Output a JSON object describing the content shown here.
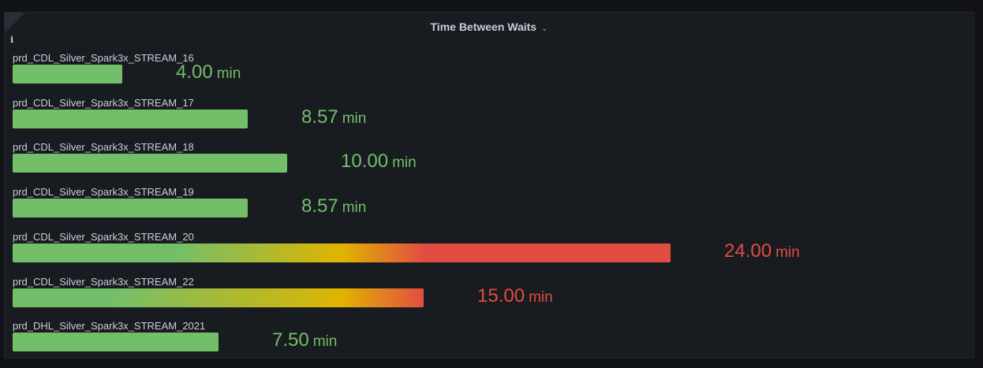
{
  "panel": {
    "title": "Time Between Waits",
    "info_icon": "info-icon",
    "menu_icon": "chevron-down-icon"
  },
  "chart_data": {
    "type": "bar",
    "orientation": "horizontal",
    "title": "Time Between Waits",
    "unit": "min",
    "xlim": [
      0,
      24
    ],
    "categories": [
      "prd_CDL_Silver_Spark3x_STREAM_16",
      "prd_CDL_Silver_Spark3x_STREAM_17",
      "prd_CDL_Silver_Spark3x_STREAM_18",
      "prd_CDL_Silver_Spark3x_STREAM_19",
      "prd_CDL_Silver_Spark3x_STREAM_20",
      "prd_CDL_Silver_Spark3x_STREAM_22",
      "prd_DHL_Silver_Spark3x_STREAM_2021"
    ],
    "values": [
      4.0,
      8.57,
      10.0,
      8.57,
      24.0,
      15.0,
      7.5
    ],
    "display_values": [
      "4.00",
      "8.57",
      "10.00",
      "8.57",
      "24.00",
      "15.00",
      "7.50"
    ],
    "thresholds": [
      {
        "from": 0,
        "color": "#73bf69"
      },
      {
        "from": 12,
        "color": "#e0b400"
      },
      {
        "from": 15,
        "color": "#e24d42"
      }
    ],
    "colors": {
      "green": "#73bf69",
      "yellow": "#e0b400",
      "red": "#e24d42"
    }
  }
}
